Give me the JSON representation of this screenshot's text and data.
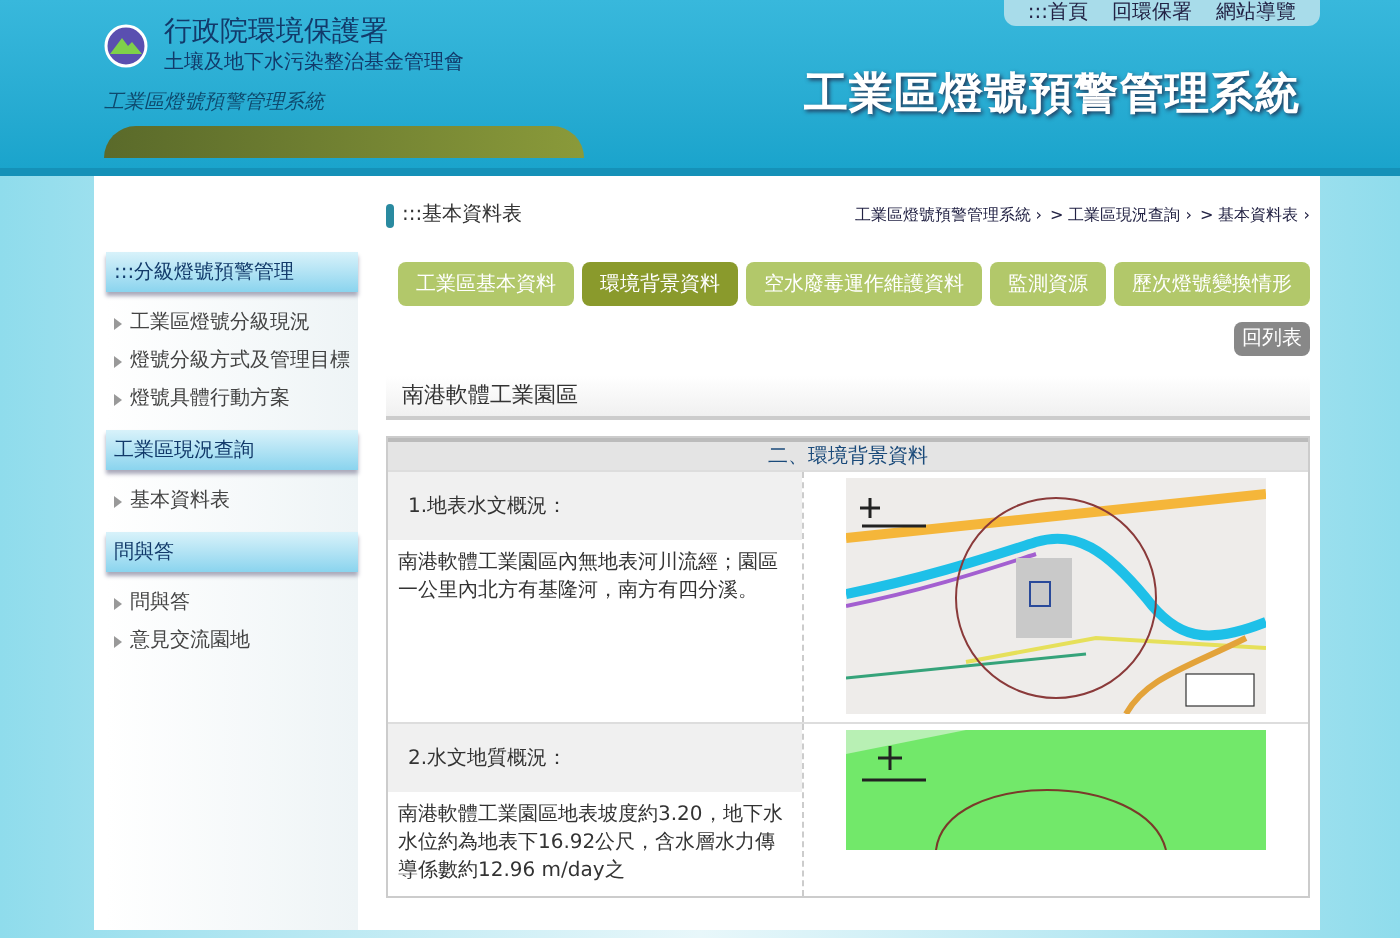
{
  "header": {
    "top_links": [
      ":::首頁",
      "回環保署",
      "網站導覽"
    ],
    "agency": "行政院環境保護署",
    "fund": "土壤及地下水污染整治基金管理會",
    "subtitle": "工業區燈號預警管理系統",
    "system_title": "工業區燈號預警管理系統"
  },
  "sidebar": {
    "sections": [
      {
        "title": ":::分級燈號預警管理",
        "items": [
          "工業區燈號分級現況",
          "燈號分級方式及管理目標",
          "燈號具體行動方案"
        ]
      },
      {
        "title": "工業區現況查詢",
        "items": [
          "基本資料表"
        ]
      },
      {
        "title": "問與答",
        "items": [
          "問與答",
          "意見交流園地"
        ]
      }
    ]
  },
  "page_title": ":::基本資料表",
  "breadcrumb": [
    "工業區燈號預警管理系統 ›",
    "> 工業區現況查詢 ›",
    "> 基本資料表 ›"
  ],
  "tabs": [
    {
      "label": "工業區基本資料",
      "selected": false
    },
    {
      "label": "環境背景資料",
      "selected": true
    },
    {
      "label": "空水廢毒運作維護資料",
      "selected": false
    },
    {
      "label": "監測資源",
      "selected": false
    },
    {
      "label": "歷次燈號變換情形",
      "selected": false
    }
  ],
  "back_button": "回列表",
  "area_title": "南港軟體工業園區",
  "table": {
    "heading": "二、環境背景資料",
    "rows": [
      {
        "label": "1.地表水文概況：",
        "text": "南港軟體工業園區內無地表河川流經；園區一公里內北方有基隆河，南方有四分溪。",
        "kind": "street"
      },
      {
        "label": "2.水文地質概況：",
        "text": "南港軟體工業園區地表坡度約3.20，地下水水位約為地表下16.92公尺，含水層水力傳導係數約12.96 m/day之",
        "kind": "geology"
      }
    ]
  }
}
